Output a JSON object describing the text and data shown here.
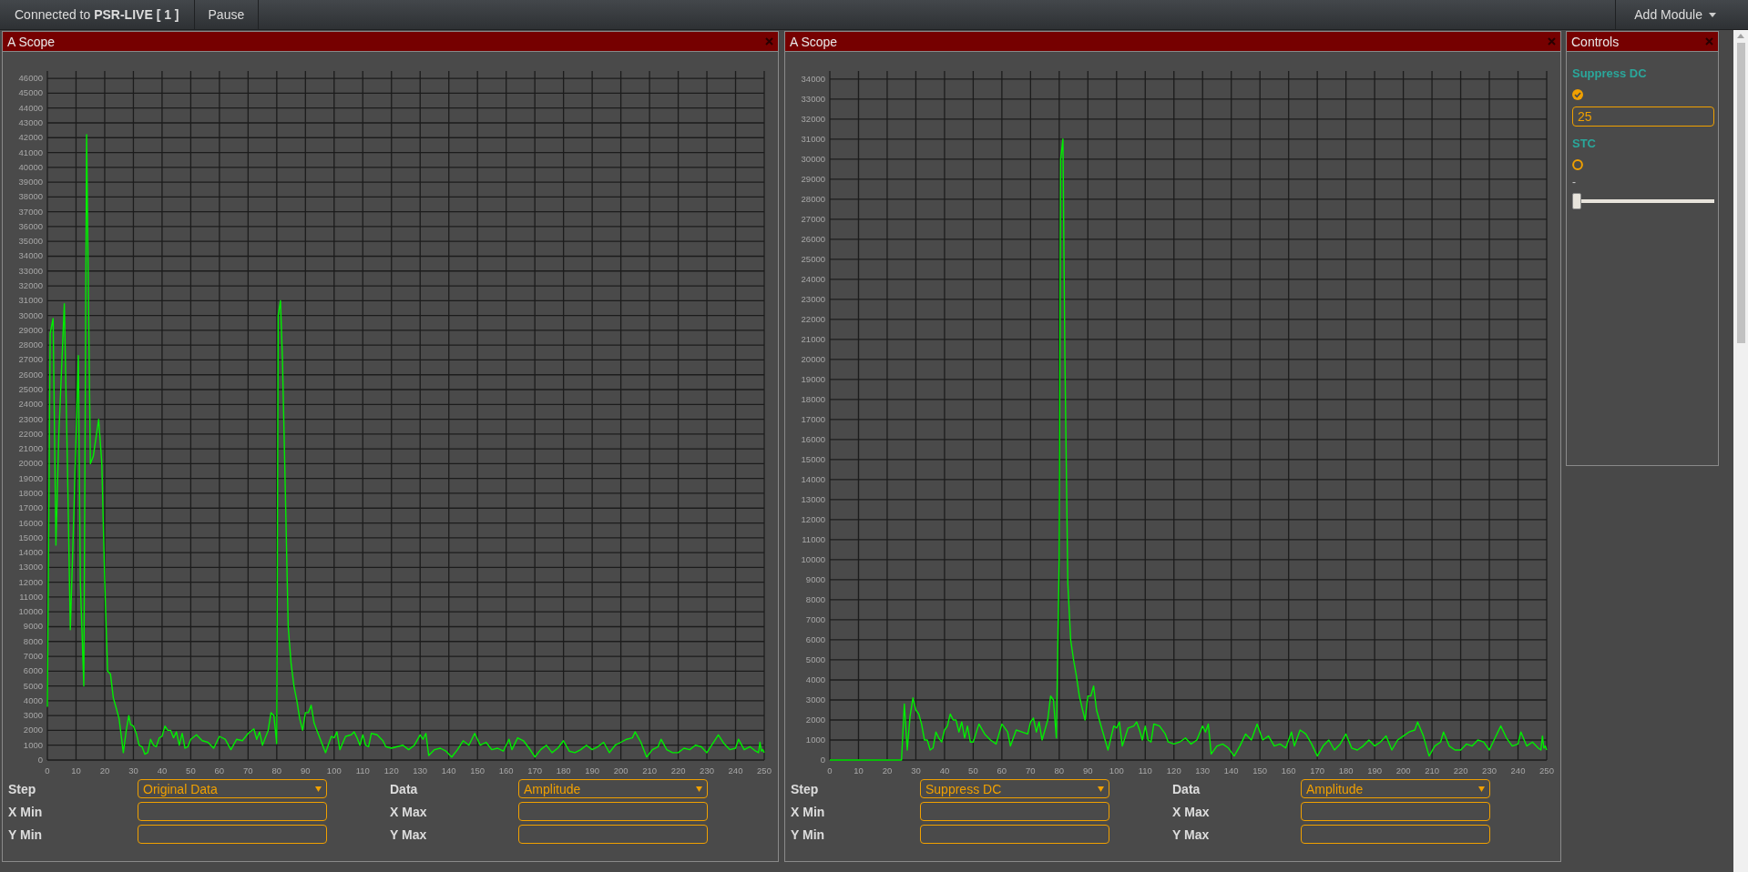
{
  "top_bar": {
    "connection": "Connected to **PSR-LIVE [ 1 ]**",
    "pause_button": "Pause",
    "add_module_button": "Add Module"
  },
  "scopes": [
    {
      "title": "A Scope",
      "chart_data": {
        "type": "line",
        "grid": true,
        "xlim": [
          0,
          250
        ],
        "ylim": [
          0,
          46500
        ],
        "xticks": [
          0,
          10,
          20,
          30,
          40,
          50,
          60,
          70,
          80,
          90,
          100,
          110,
          120,
          130,
          140,
          150,
          160,
          170,
          180,
          190,
          200,
          210,
          220,
          230,
          240,
          250
        ],
        "yticks": [
          0,
          1000,
          2000,
          3000,
          4000,
          5000,
          6000,
          7000,
          8000,
          9000,
          10000,
          11000,
          12000,
          13000,
          14000,
          15000,
          16000,
          17000,
          18000,
          19000,
          20000,
          21000,
          22000,
          23000,
          24000,
          25000,
          26000,
          27000,
          28000,
          29000,
          30000,
          31000,
          32000,
          33000,
          34000,
          35000,
          36000,
          37000,
          38000,
          39000,
          40000,
          41000,
          42000,
          43000,
          44000,
          45000,
          46000
        ],
        "x": [
          0,
          1,
          2,
          3,
          4,
          5.9,
          7,
          8,
          9,
          10.8,
          11.5,
          12.7,
          13.7,
          15,
          16,
          17.9,
          19,
          20,
          21,
          22,
          23,
          24,
          25,
          26.5,
          27.5,
          28.4,
          29,
          30,
          31,
          32,
          33,
          34,
          35,
          36,
          37,
          38,
          39,
          40,
          41,
          42,
          43,
          44,
          45,
          46,
          47,
          48,
          49,
          50,
          52,
          54,
          56,
          58,
          60,
          62,
          64,
          66,
          68,
          70,
          72,
          73,
          74,
          75,
          77,
          78,
          79,
          80,
          80.5,
          81.3,
          82,
          83,
          84,
          85,
          86,
          87,
          88,
          89,
          90,
          91,
          92,
          93,
          94,
          96,
          97,
          99,
          100,
          101,
          102,
          104,
          106,
          107,
          108,
          109,
          110,
          111,
          112,
          113,
          115,
          117,
          118,
          120,
          122,
          124,
          126,
          128,
          130,
          131,
          132,
          133,
          135,
          137,
          139,
          141,
          143,
          145,
          147,
          149,
          151,
          153,
          155,
          157,
          159,
          161,
          162,
          164,
          166,
          168,
          170,
          172,
          174,
          176,
          178,
          180,
          182,
          184,
          186,
          188,
          190,
          192,
          194,
          196,
          198,
          200,
          202,
          204,
          205,
          207,
          209,
          211,
          213,
          214,
          216,
          218,
          220,
          222,
          224,
          226,
          228,
          230,
          232,
          234,
          236,
          238,
          240,
          241,
          243,
          245,
          247,
          248,
          248.5,
          249,
          249.5,
          250
        ],
        "values": [
          3600,
          28800,
          29800,
          14500,
          22000,
          30800,
          20000,
          8800,
          15000,
          27300,
          12000,
          5000,
          42200,
          20000,
          20500,
          23000,
          20000,
          12000,
          6000,
          5800,
          4200,
          3500,
          2800,
          500,
          2000,
          3000,
          2400,
          2300,
          1800,
          1000,
          900,
          400,
          500,
          1400,
          1000,
          900,
          1500,
          1600,
          2300,
          2000,
          2000,
          1500,
          1900,
          1000,
          1800,
          800,
          900,
          1400,
          1700,
          1300,
          1200,
          800,
          1600,
          1400,
          700,
          1400,
          1300,
          1800,
          2100,
          1400,
          1900,
          1000,
          2000,
          3200,
          3000,
          1100,
          30000,
          31000,
          27000,
          18000,
          9000,
          6500,
          5000,
          4000,
          2800,
          2000,
          3200,
          3200,
          3700,
          2500,
          2000,
          1000,
          500,
          1600,
          1500,
          1900,
          700,
          1600,
          1700,
          1900,
          1500,
          1000,
          1700,
          1000,
          900,
          1800,
          1700,
          1300,
          900,
          800,
          900,
          1000,
          700,
          1000,
          1700,
          1400,
          1800,
          300,
          700,
          800,
          600,
          200,
          700,
          1300,
          1000,
          1800,
          1000,
          1200,
          700,
          800,
          600,
          1400,
          700,
          1500,
          1300,
          800,
          200,
          700,
          1000,
          500,
          800,
          1300,
          600,
          500,
          700,
          1000,
          700,
          900,
          1200,
          500,
          1000,
          1200,
          1400,
          1500,
          1900,
          1200,
          200,
          700,
          900,
          1400,
          700,
          500,
          500,
          800,
          700,
          1000,
          900,
          500,
          1100,
          1700,
          1100,
          700,
          800,
          1400,
          700,
          900,
          600,
          500,
          1200,
          600,
          700,
          500
        ]
      },
      "fields": [
        {
          "label": "Step",
          "kind": "select",
          "value": "Original Data"
        },
        {
          "label": "Data",
          "kind": "select",
          "value": "Amplitude"
        },
        {
          "label": "X Min",
          "kind": "input"
        },
        {
          "label": "X Max",
          "kind": "input"
        },
        {
          "label": "Y Min",
          "kind": "input"
        },
        {
          "label": "Y Max",
          "kind": "input"
        }
      ]
    },
    {
      "title": "A Scope",
      "chart_data": {
        "type": "line",
        "grid": true,
        "xlim": [
          0,
          250
        ],
        "ylim": [
          0,
          34400
        ],
        "xticks": [
          0,
          10,
          20,
          30,
          40,
          50,
          60,
          70,
          80,
          90,
          100,
          110,
          120,
          130,
          140,
          150,
          160,
          170,
          180,
          190,
          200,
          210,
          220,
          230,
          240,
          250
        ],
        "yticks": [
          0,
          1000,
          2000,
          3000,
          4000,
          5000,
          6000,
          7000,
          8000,
          9000,
          10000,
          11000,
          12000,
          13000,
          14000,
          15000,
          16000,
          17000,
          18000,
          19000,
          20000,
          21000,
          22000,
          23000,
          24000,
          25000,
          26000,
          27000,
          28000,
          29000,
          30000,
          31000,
          32000,
          33000,
          34000
        ],
        "x": [
          0,
          10,
          20,
          25,
          26,
          27,
          28,
          29,
          30,
          31,
          32,
          33,
          34,
          35,
          36,
          37,
          38,
          39,
          40,
          41,
          42,
          43,
          44,
          45,
          46,
          47,
          48,
          49,
          50,
          52,
          54,
          56,
          58,
          60,
          62,
          63,
          65,
          67,
          69,
          70,
          71,
          72,
          73,
          74,
          76,
          77,
          78,
          79,
          80,
          80.5,
          81.3,
          82,
          83,
          84,
          85,
          86,
          87,
          88,
          89,
          90,
          91,
          92,
          93,
          94,
          96,
          97,
          99,
          100,
          101,
          102,
          104,
          106,
          107,
          108,
          109,
          110,
          111,
          112,
          113,
          115,
          117,
          118,
          120,
          122,
          124,
          126,
          128,
          130,
          131,
          132,
          133,
          135,
          137,
          139,
          141,
          143,
          145,
          147,
          149,
          151,
          153,
          155,
          157,
          159,
          161,
          162,
          164,
          166,
          168,
          170,
          172,
          174,
          176,
          178,
          180,
          182,
          184,
          186,
          188,
          190,
          192,
          194,
          196,
          198,
          200,
          202,
          204,
          205,
          207,
          209,
          211,
          213,
          214,
          216,
          218,
          220,
          222,
          224,
          226,
          228,
          230,
          232,
          234,
          236,
          238,
          240,
          241,
          243,
          245,
          247,
          248,
          248.5,
          249,
          249.5,
          250
        ],
        "values": [
          0,
          0,
          0,
          0,
          2800,
          500,
          2200,
          3100,
          2500,
          2300,
          1800,
          1000,
          1000,
          500,
          600,
          1400,
          1100,
          900,
          1500,
          1700,
          2300,
          2000,
          2000,
          1400,
          1900,
          1100,
          1700,
          900,
          900,
          1800,
          1300,
          1000,
          800,
          1800,
          1400,
          700,
          1500,
          1400,
          1300,
          1900,
          2100,
          1400,
          1900,
          1000,
          2000,
          3200,
          3000,
          1100,
          10000,
          30000,
          31000,
          20000,
          8800,
          6000,
          5000,
          4200,
          3200,
          2600,
          2000,
          3200,
          3200,
          3700,
          2500,
          2000,
          1000,
          500,
          1700,
          1600,
          1900,
          700,
          1600,
          1700,
          1900,
          1500,
          1000,
          1700,
          1000,
          900,
          1800,
          1700,
          1300,
          900,
          800,
          900,
          1100,
          800,
          1000,
          1700,
          1400,
          1800,
          300,
          700,
          800,
          600,
          200,
          700,
          1300,
          1000,
          1800,
          1000,
          1200,
          700,
          800,
          600,
          1400,
          700,
          1500,
          1300,
          800,
          200,
          700,
          1000,
          500,
          800,
          1300,
          600,
          500,
          700,
          1000,
          700,
          900,
          1200,
          500,
          1000,
          1200,
          1400,
          1500,
          1900,
          1200,
          200,
          700,
          900,
          1400,
          700,
          500,
          500,
          800,
          700,
          1000,
          900,
          500,
          1100,
          1700,
          1100,
          700,
          800,
          1400,
          700,
          900,
          600,
          500,
          1200,
          600,
          700,
          500
        ]
      },
      "fields": [
        {
          "label": "Step",
          "kind": "select",
          "value": "Suppress DC"
        },
        {
          "label": "Data",
          "kind": "select",
          "value": "Amplitude"
        },
        {
          "label": "X Min",
          "kind": "input"
        },
        {
          "label": "X Max",
          "kind": "input"
        },
        {
          "label": "Y Min",
          "kind": "input"
        },
        {
          "label": "Y Max",
          "kind": "input"
        }
      ]
    }
  ],
  "controls": {
    "title": "Controls",
    "items": [
      {
        "kind": "heading",
        "text": "Suppress DC"
      },
      {
        "kind": "toggle",
        "checked": true
      },
      {
        "kind": "input",
        "value": "25"
      },
      {
        "kind": "heading",
        "text": "STC"
      },
      {
        "kind": "toggle",
        "checked": false
      },
      {
        "kind": "label",
        "text": "-"
      },
      {
        "kind": "slider",
        "level": 0
      }
    ]
  }
}
